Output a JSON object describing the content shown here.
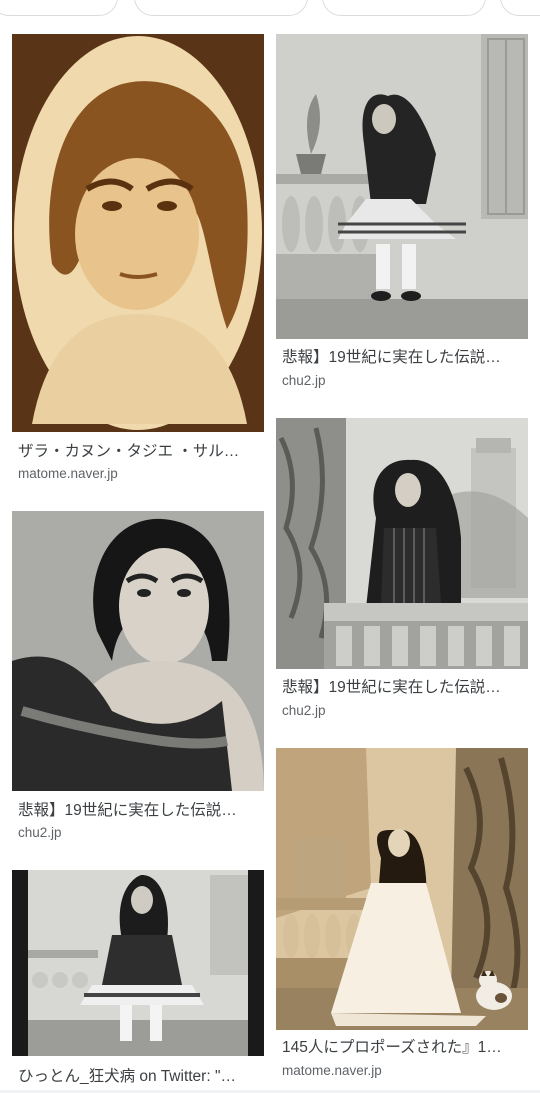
{
  "filter_chips": [
    "",
    "",
    "",
    ""
  ],
  "results": [
    {
      "caption": "ザラ・カヌン・タジエ ・サル…",
      "source": "matome.naver.jp",
      "image": "oval-sepia-portrait"
    },
    {
      "caption": "悲報】19世紀に実在した伝説…",
      "source": "chu2.jp",
      "image": "standing-woman-studio"
    },
    {
      "caption": "悲報】19世紀に実在した伝説…",
      "source": "chu2.jp",
      "image": "woman-leaning-on-balustrade"
    },
    {
      "caption": "悲報】19世紀に実在した伝説…",
      "source": "chu2.jp",
      "image": "portrait-with-shawl"
    },
    {
      "caption": "145人にプロポーズされた』1…",
      "source": "matome.naver.jp",
      "image": "woman-in-white-gown-with-cat"
    },
    {
      "caption": "ひっとん_狂犬病 on Twitter: \"…",
      "source": "",
      "image": "standing-woman-studio"
    }
  ],
  "colors": {
    "caption": "#3c4043",
    "source": "#5f6368",
    "chip_border": "#dadce0"
  }
}
